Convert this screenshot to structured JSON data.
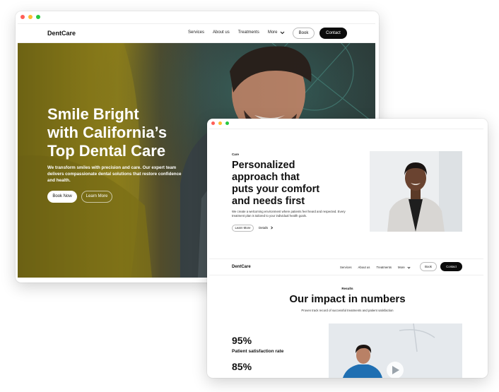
{
  "colors": {
    "dot_close": "#ff5f57",
    "dot_min": "#febc2e",
    "dot_max": "#28c840",
    "primary_button": "#0b0b0b"
  },
  "window1": {
    "nav": {
      "logo": "DentCare",
      "links": [
        "Services",
        "About us",
        "Treatments"
      ],
      "more": "More",
      "book": "Book",
      "contact": "Contact"
    },
    "hero": {
      "title_lines": [
        "Smile Bright",
        "with California’s",
        "Top Dental Care"
      ],
      "subtitle": "We transform smiles with precision and care. Our expert team delivers compassionate dental solutions that restore confidence and health.",
      "primary_cta": "Book Now",
      "secondary_cta": "Learn More"
    }
  },
  "window2": {
    "care": {
      "tag": "Care",
      "title_lines": [
        "Personalized",
        "approach that",
        "puts your comfort",
        "and needs first"
      ],
      "description": "We create a welcoming environment where patients feel heard and respected. Every treatment plan is tailored to your individual health goals.",
      "learn_more": "Learn More",
      "details": "Details",
      "details_icon": "chevron-right-icon"
    },
    "nav": {
      "logo": "DentCare",
      "links": [
        "Services",
        "About us",
        "Treatments"
      ],
      "more": "More",
      "book": "Book",
      "contact": "Contact"
    },
    "impact": {
      "tag": "Results",
      "title": "Our impact in numbers",
      "subtitle": "Proven track record of successful treatments and patient satisfaction",
      "stats": [
        {
          "value": "95%",
          "label": "Patient satisfaction rate"
        },
        {
          "value": "85%",
          "label": ""
        }
      ],
      "video_icon": "play-icon"
    }
  }
}
